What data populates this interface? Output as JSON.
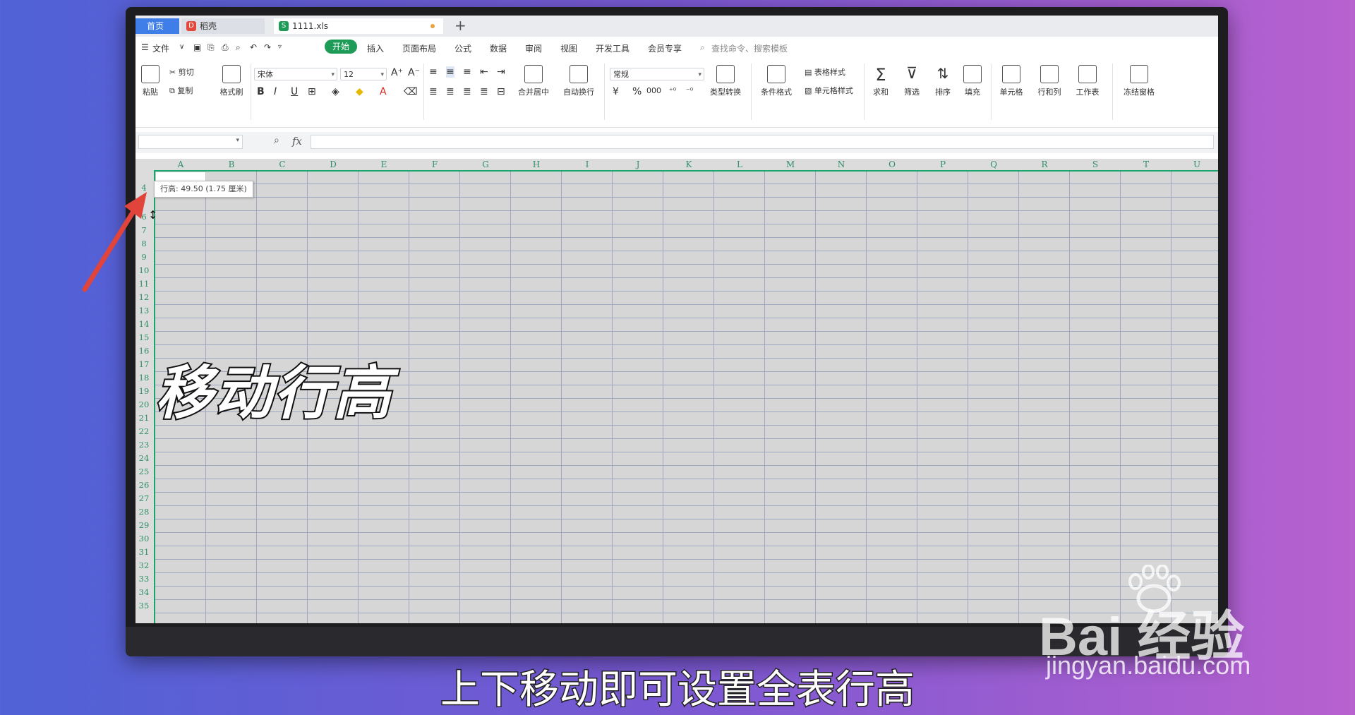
{
  "tabs": {
    "home": "首页",
    "daoke": "稻壳",
    "file": "1111.xls",
    "new": "+"
  },
  "menu": {
    "file": "文件",
    "start": "开始",
    "items": [
      "插入",
      "页面布局",
      "公式",
      "数据",
      "审阅",
      "视图",
      "开发工具",
      "会员专享"
    ],
    "search": "查找命令、搜索模板"
  },
  "ribbon": {
    "paste": "粘贴",
    "cut": "剪切",
    "copy": "复制",
    "painter": "格式刷",
    "font": "宋体",
    "size": "12",
    "bold": "B",
    "italic": "I",
    "underline": "U",
    "merge": "合并居中",
    "wrap": "自动换行",
    "numfmt": "常规",
    "convert": "类型转换",
    "cond": "条件格式",
    "tablestyle": "表格样式",
    "cellstyle": "单元格样式",
    "sum": "求和",
    "filter": "筛选",
    "sort": "排序",
    "fill": "填充",
    "cell": "单元格",
    "rowcol": "行和列",
    "sheet": "工作表",
    "freeze": "冻结窗格",
    "currency": "¥",
    "percent": "%",
    "thousands": "000"
  },
  "formula": {
    "fx": "fx"
  },
  "columns": [
    "A",
    "B",
    "C",
    "D",
    "E",
    "F",
    "G",
    "H",
    "I",
    "J",
    "K",
    "L",
    "M",
    "N",
    "O",
    "P",
    "Q",
    "R",
    "S",
    "T",
    "U"
  ],
  "rows": [
    "4",
    "",
    "6",
    "7",
    "8",
    "9",
    "10",
    "11",
    "12",
    "13",
    "14",
    "15",
    "16",
    "17",
    "18",
    "19",
    "20",
    "21",
    "22",
    "23",
    "24",
    "25",
    "26",
    "27",
    "28",
    "29",
    "30",
    "31",
    "32",
    "33",
    "34",
    "35"
  ],
  "tooltip": "行高: 49.50 (1.75 厘米)",
  "overlay_title": "移动行高",
  "subtitle": "上下移动即可设置全表行高",
  "watermark": {
    "brand": "Bai 经验",
    "url": "jingyan.baidu.com"
  }
}
